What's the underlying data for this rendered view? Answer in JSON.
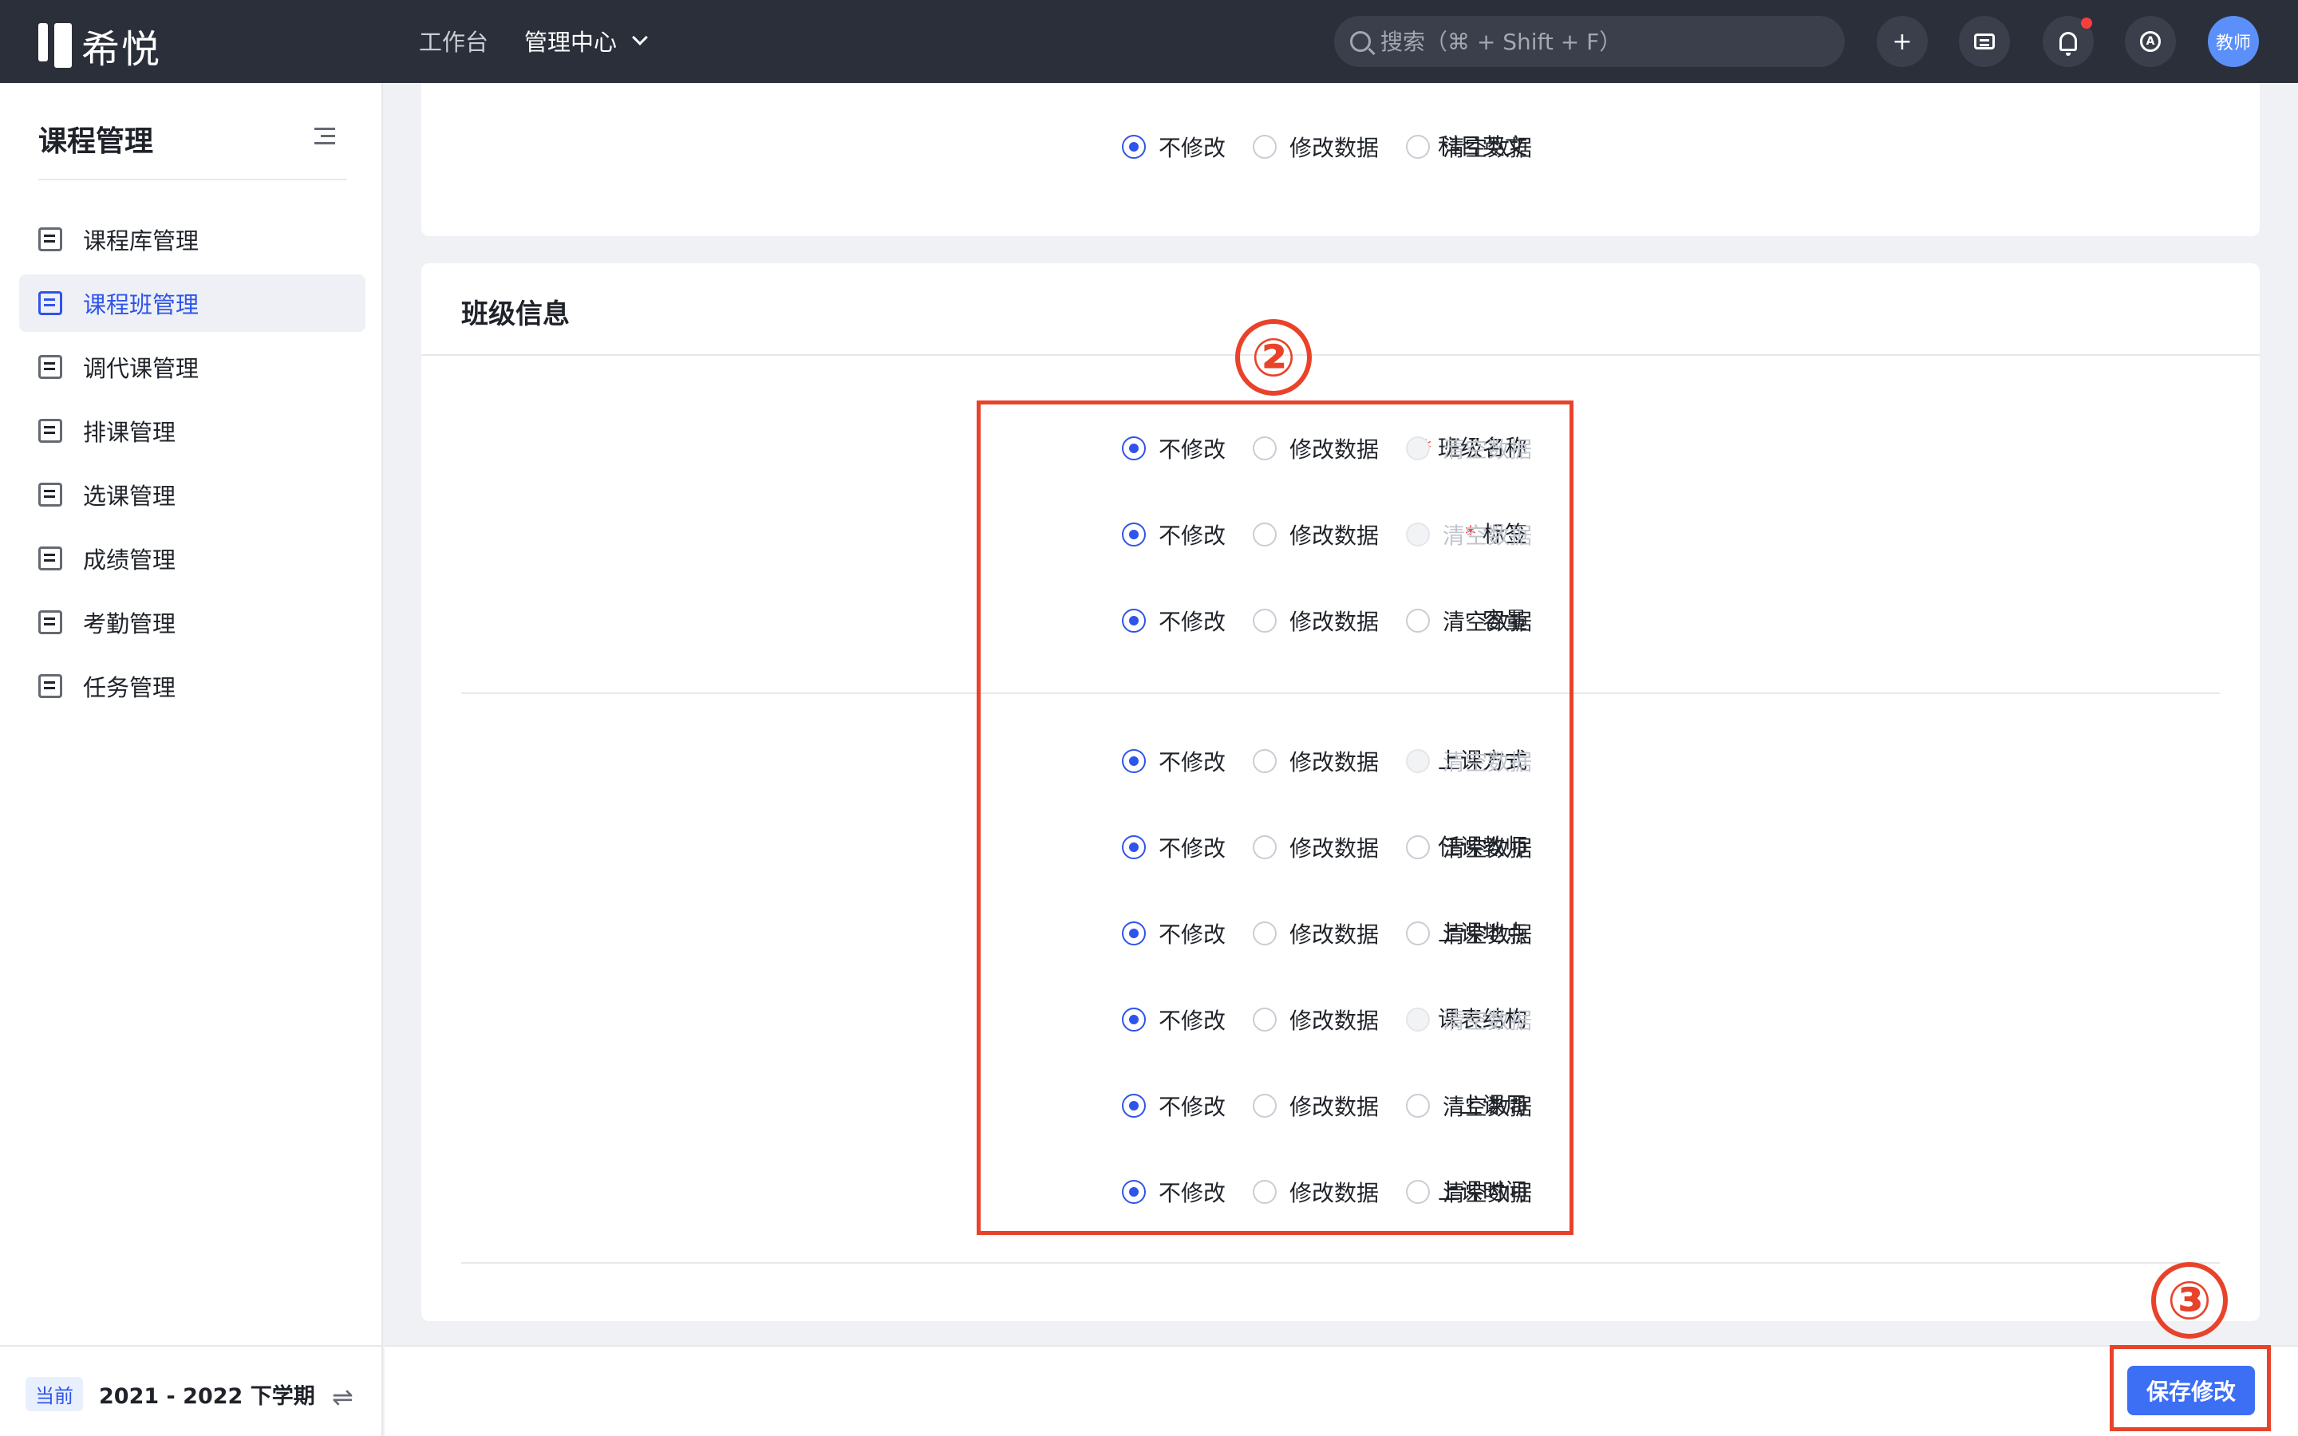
{
  "app": {
    "name": "希悦"
  },
  "topnav": {
    "workbench": "工作台",
    "admin": "管理中心"
  },
  "search": {
    "placeholder": "搜索（⌘ + Shift + F）"
  },
  "toolbar": {
    "add": "+",
    "help": "A"
  },
  "user": {
    "avatar": "教师"
  },
  "sidebar": {
    "title": "课程管理",
    "items": [
      {
        "label": "课程库管理",
        "active": false
      },
      {
        "label": "课程班管理",
        "active": true
      },
      {
        "label": "调代课管理",
        "active": false
      },
      {
        "label": "排课管理",
        "active": false
      },
      {
        "label": "选课管理",
        "active": false
      },
      {
        "label": "成绩管理",
        "active": false
      },
      {
        "label": "考勤管理",
        "active": false
      },
      {
        "label": "任务管理",
        "active": false
      }
    ],
    "footer": {
      "badge": "当前",
      "term": "2021 - 2022 下学期",
      "swap": "⇌"
    }
  },
  "options": {
    "keep": "不修改",
    "modify": "修改数据",
    "clear": "清空数据"
  },
  "top_section": {
    "rows": [
      {
        "label": "科目英文",
        "required": false,
        "selected": "keep",
        "clear_disabled": false
      }
    ]
  },
  "class_info": {
    "title": "班级信息",
    "rows": [
      {
        "label": "班级名称",
        "required": true,
        "selected": "keep",
        "clear_disabled": true
      },
      {
        "label": "标签",
        "required": true,
        "selected": "keep",
        "clear_disabled": true
      },
      {
        "label": "容量",
        "required": false,
        "selected": "keep",
        "clear_disabled": false
      },
      {
        "label": "上课方式",
        "required": false,
        "selected": "keep",
        "clear_disabled": true
      },
      {
        "label": "任课教师",
        "required": false,
        "selected": "keep",
        "clear_disabled": false
      },
      {
        "label": "上课地点",
        "required": false,
        "selected": "keep",
        "clear_disabled": false
      },
      {
        "label": "课表结构",
        "required": false,
        "selected": "keep",
        "clear_disabled": true
      },
      {
        "label": "上课周",
        "required": false,
        "selected": "keep",
        "clear_disabled": false
      },
      {
        "label": "上课时间",
        "required": false,
        "selected": "keep",
        "clear_disabled": false
      }
    ]
  },
  "annotations": {
    "step2": "②",
    "step3": "③",
    "color": "#e8432a"
  },
  "actions": {
    "save": "保存修改"
  },
  "colors": {
    "primary": "#3d6ff5",
    "topbar": "#2b2f3a",
    "active_menu": "#2f54eb"
  }
}
